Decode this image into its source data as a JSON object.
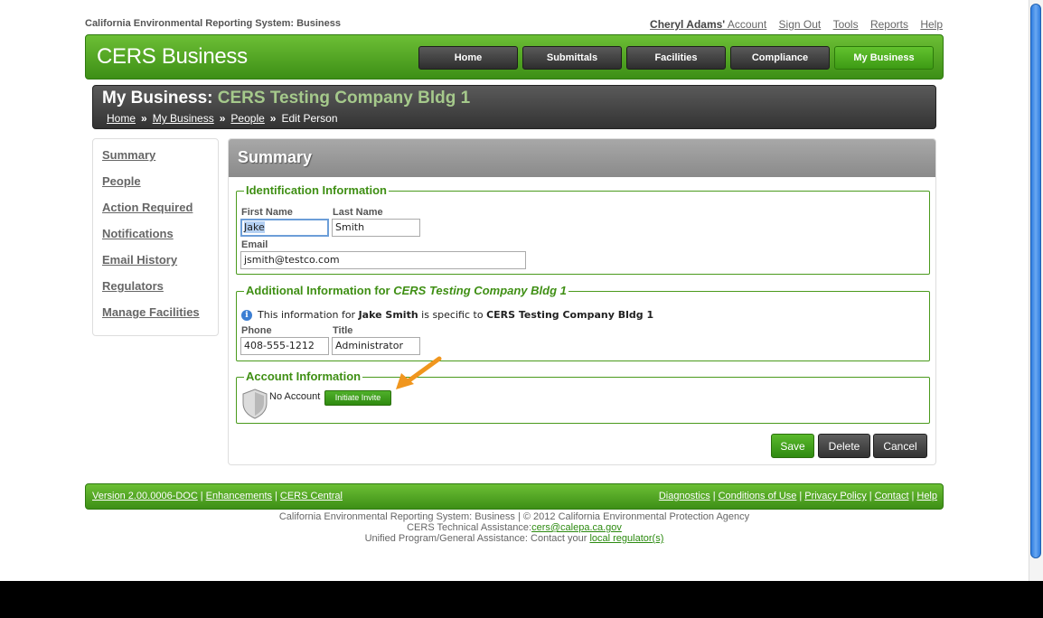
{
  "app_title": "California Environmental Reporting System: Business",
  "utility": {
    "account_name": "Cheryl Adams'",
    "account_suffix": "Account",
    "sign_out": "Sign Out",
    "tools": "Tools",
    "reports": "Reports",
    "help": "Help"
  },
  "header": {
    "logo": "CERS Business",
    "nav": [
      "Home",
      "Submittals",
      "Facilities",
      "Compliance",
      "My Business"
    ],
    "active_nav": "My Business"
  },
  "page": {
    "title_prefix": "My Business:",
    "title_company": "CERS Testing Company Bldg 1",
    "breadcrumb": [
      "Home",
      "My Business",
      "People"
    ],
    "breadcrumb_current": "Edit Person",
    "breadcrumb_separator": "»"
  },
  "sidebar": {
    "items": [
      "Summary",
      "People",
      "Action Required",
      "Notifications",
      "Email History",
      "Regulators",
      "Manage Facilities"
    ]
  },
  "panel": {
    "title": "Summary",
    "identification": {
      "legend": "Identification Information",
      "first_name_label": "First Name",
      "first_name_value": "Jake",
      "last_name_label": "Last Name",
      "last_name_value": "Smith",
      "email_label": "Email",
      "email_value": "jsmith@testco.com"
    },
    "additional": {
      "legend_prefix": "Additional Information for",
      "legend_company": "CERS Testing Company Bldg 1",
      "info_prefix": "This information for",
      "info_person": "Jake Smith",
      "info_middle": "is specific to",
      "info_company": "CERS Testing Company Bldg 1",
      "phone_label": "Phone",
      "phone_value": "408-555-1212",
      "title_label": "Title",
      "title_value": "Administrator"
    },
    "account": {
      "legend": "Account Information",
      "status": "No Account",
      "invite_button": "Initiate Invite"
    },
    "buttons": {
      "save": "Save",
      "delete": "Delete",
      "cancel": "Cancel"
    }
  },
  "footer": {
    "left_links": [
      "Version 2.00.0006-DOC",
      "Enhancements",
      "CERS Central"
    ],
    "right_links": [
      "Diagnostics",
      "Conditions of Use",
      "Privacy Policy",
      "Contact",
      "Help"
    ],
    "line1": "California Environmental Reporting System: Business | © 2012 California Environmental Protection Agency",
    "line2_prefix": "CERS Technical Assistance:",
    "line2_email": "cers@calepa.ca.gov",
    "line3_prefix": "Unified Program/General Assistance: Contact your",
    "line3_link": "local regulator(s)"
  },
  "colors": {
    "brand_green": "#3d8f16",
    "annotation_arrow": "#f0961e"
  }
}
